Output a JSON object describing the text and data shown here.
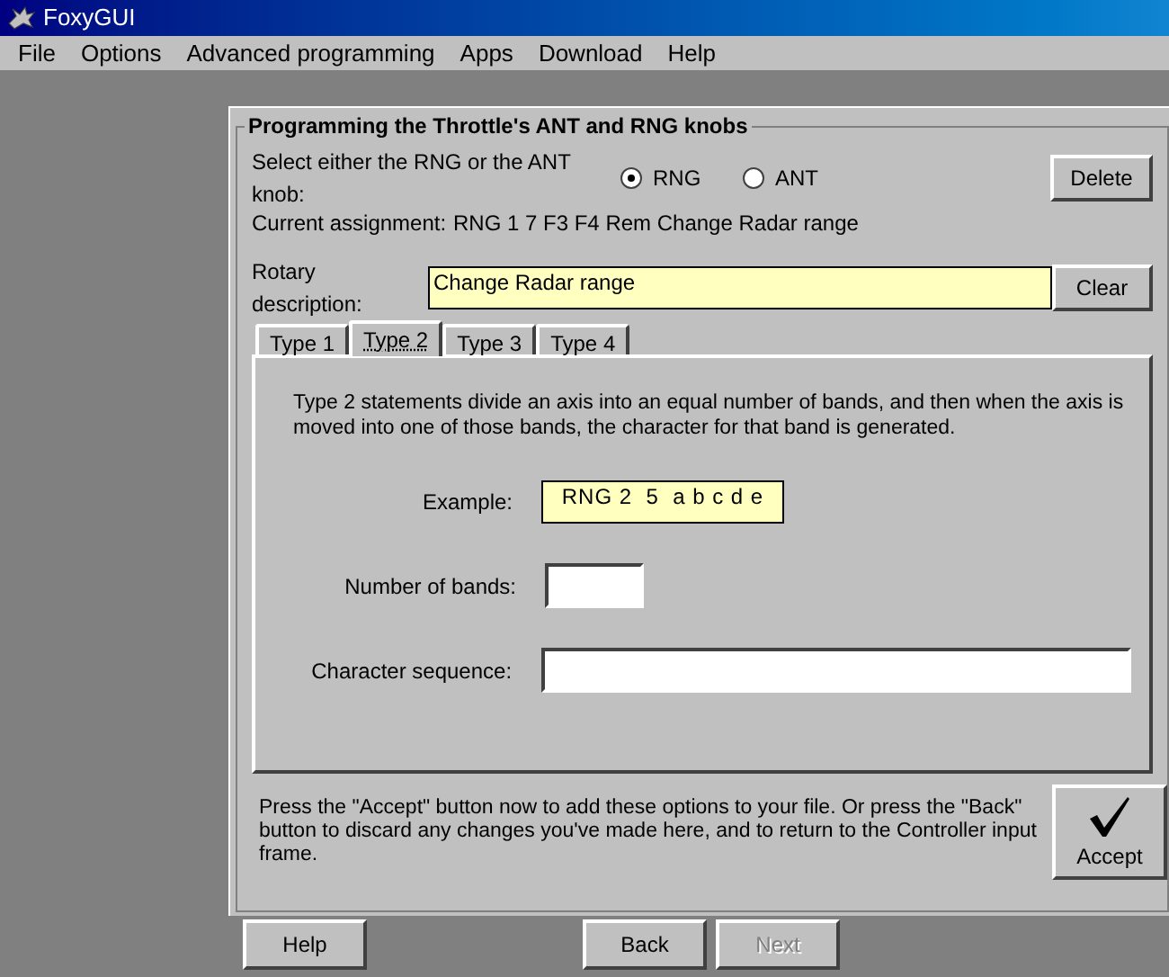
{
  "window": {
    "title": "FoxyGUI"
  },
  "menu": [
    {
      "label": "File"
    },
    {
      "label": "Options"
    },
    {
      "label": "Advanced programming"
    },
    {
      "label": "Apps"
    },
    {
      "label": "Download"
    },
    {
      "label": "Help"
    }
  ],
  "group": {
    "title": "Programming the Throttle's ANT and RNG knobs",
    "select_label": "Select either the RNG or the ANT knob:",
    "radios": [
      {
        "label": "RNG",
        "selected": true
      },
      {
        "label": "ANT",
        "selected": false
      }
    ],
    "delete_button": "Delete",
    "assignment_label": "Current assignment:",
    "assignment_value": "RNG 1 7 F3 F4  Rem Change Radar range",
    "description_label": "Rotary description:",
    "description_value": "Change Radar range",
    "clear_button": "Clear",
    "tabs": [
      {
        "label": "Type 1",
        "selected": false
      },
      {
        "label": "Type 2",
        "selected": true
      },
      {
        "label": "Type 3",
        "selected": false
      },
      {
        "label": "Type 4",
        "selected": false
      }
    ],
    "tab_panel": {
      "text": "Type 2 statements divide an axis into an equal number of bands, and then when the axis is moved into one of those bands, the character for that band is generated.",
      "example_label": "Example:",
      "example_value": "RNG 2  5  a b c d e",
      "bands_label": "Number of bands:",
      "sequence_label": "Character sequence:"
    },
    "note": "Press the \"Accept\" button now to add these options to your file.  Or press the \"Back\" button to discard any changes you've made here, and to return to the Controller input frame.",
    "accept_button": "Accept"
  },
  "bottom_buttons": [
    {
      "label": "Help",
      "disabled": false
    },
    {
      "label": "Back",
      "disabled": false
    },
    {
      "label": "Next",
      "disabled": true
    }
  ]
}
